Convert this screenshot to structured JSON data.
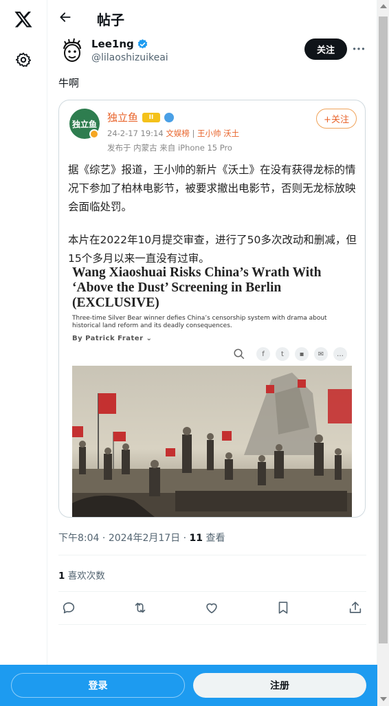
{
  "nav": {
    "logo_icon": "x-logo-icon",
    "settings_icon": "gear-icon"
  },
  "header": {
    "title": "帖子",
    "back_icon": "arrow-left-icon"
  },
  "author": {
    "name": "Lee1ng",
    "handle": "@lilaoshizuikeai",
    "follow_label": "关注",
    "verified": true
  },
  "tweet": {
    "text": "牛啊"
  },
  "embed": {
    "account": "独立鱼",
    "avatar_text": "独立鱼",
    "level": "II",
    "follow_label": "+关注",
    "date": "24-2-17 19:14",
    "tag1": "文娱榜",
    "tag2": "王小帅 沃土",
    "source": "发布于 内蒙古  来自 iPhone 15 Pro",
    "paragraph1": "据《综艺》报道，王小帅的新片《沃土》在没有获得龙标的情况下参加了柏林电影节，被要求撤出电影节，否则无龙标放映会面临处罚。",
    "paragraph2": "本片在2022年10月提交审查，进行了50多次改动和删减，但15个多月以来一直没有过审。",
    "article_title": "Wang Xiaoshuai Risks China’s Wrath With ‘Above the Dust’ Screening in Berlin (EXCLUSIVE)",
    "article_subtitle": "Three-time Silver Bear winner defies China’s censorship system with drama about historical land reform and its deadly consequences.",
    "article_byline": "By Patrick Frater"
  },
  "meta": {
    "time": "下午8:04",
    "sep": " · ",
    "date": "2024年2月17日",
    "views_count": "11",
    "views_label": " 查看",
    "likes_count": "1",
    "likes_label": " 喜欢次数"
  },
  "actions": [
    "reply-icon",
    "retweet-icon",
    "like-icon",
    "bookmark-icon",
    "share-icon"
  ],
  "bottom_bar": {
    "login_label": "登录",
    "signup_label": "注册"
  },
  "colors": {
    "accent": "#1d9bf0",
    "text": "#0f1419",
    "muted": "#536471",
    "weibo_orange": "#e8632a"
  }
}
